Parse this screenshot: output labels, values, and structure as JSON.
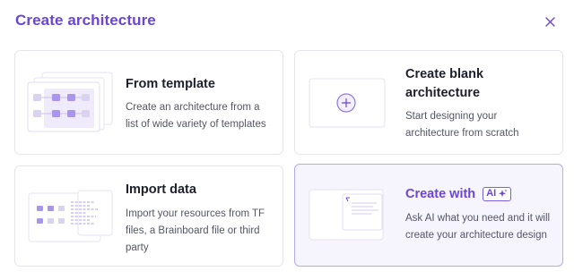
{
  "dialog": {
    "title": "Create architecture",
    "close_icon": "close-icon"
  },
  "cards": {
    "template": {
      "title": "From template",
      "description": "Create an architecture from a list of wide variety of templates",
      "desc_line1": "Create an architecture from a",
      "desc_line2": "list of wide variety of templates"
    },
    "blank": {
      "title_line1": "Create blank",
      "title_line2": "architecture",
      "desc_line1": "Start designing your",
      "desc_line2": "architecture from scratch",
      "icon": "plus-icon"
    },
    "import": {
      "title": "Import data",
      "desc_line1": "Import your resources from TF",
      "desc_line2": "files, a Brainboard file or third",
      "desc_line3": "party"
    },
    "ai": {
      "title": "Create with",
      "badge": "AI",
      "badge_icon": "sparkle-icon",
      "desc_line1": "Ask AI what you need and it will",
      "desc_line2": "create your architecture design",
      "selected": true
    }
  },
  "colors": {
    "accent": "#6a45d6",
    "border": "#e7e4ee",
    "selected_bg": "#f6f4fd"
  }
}
